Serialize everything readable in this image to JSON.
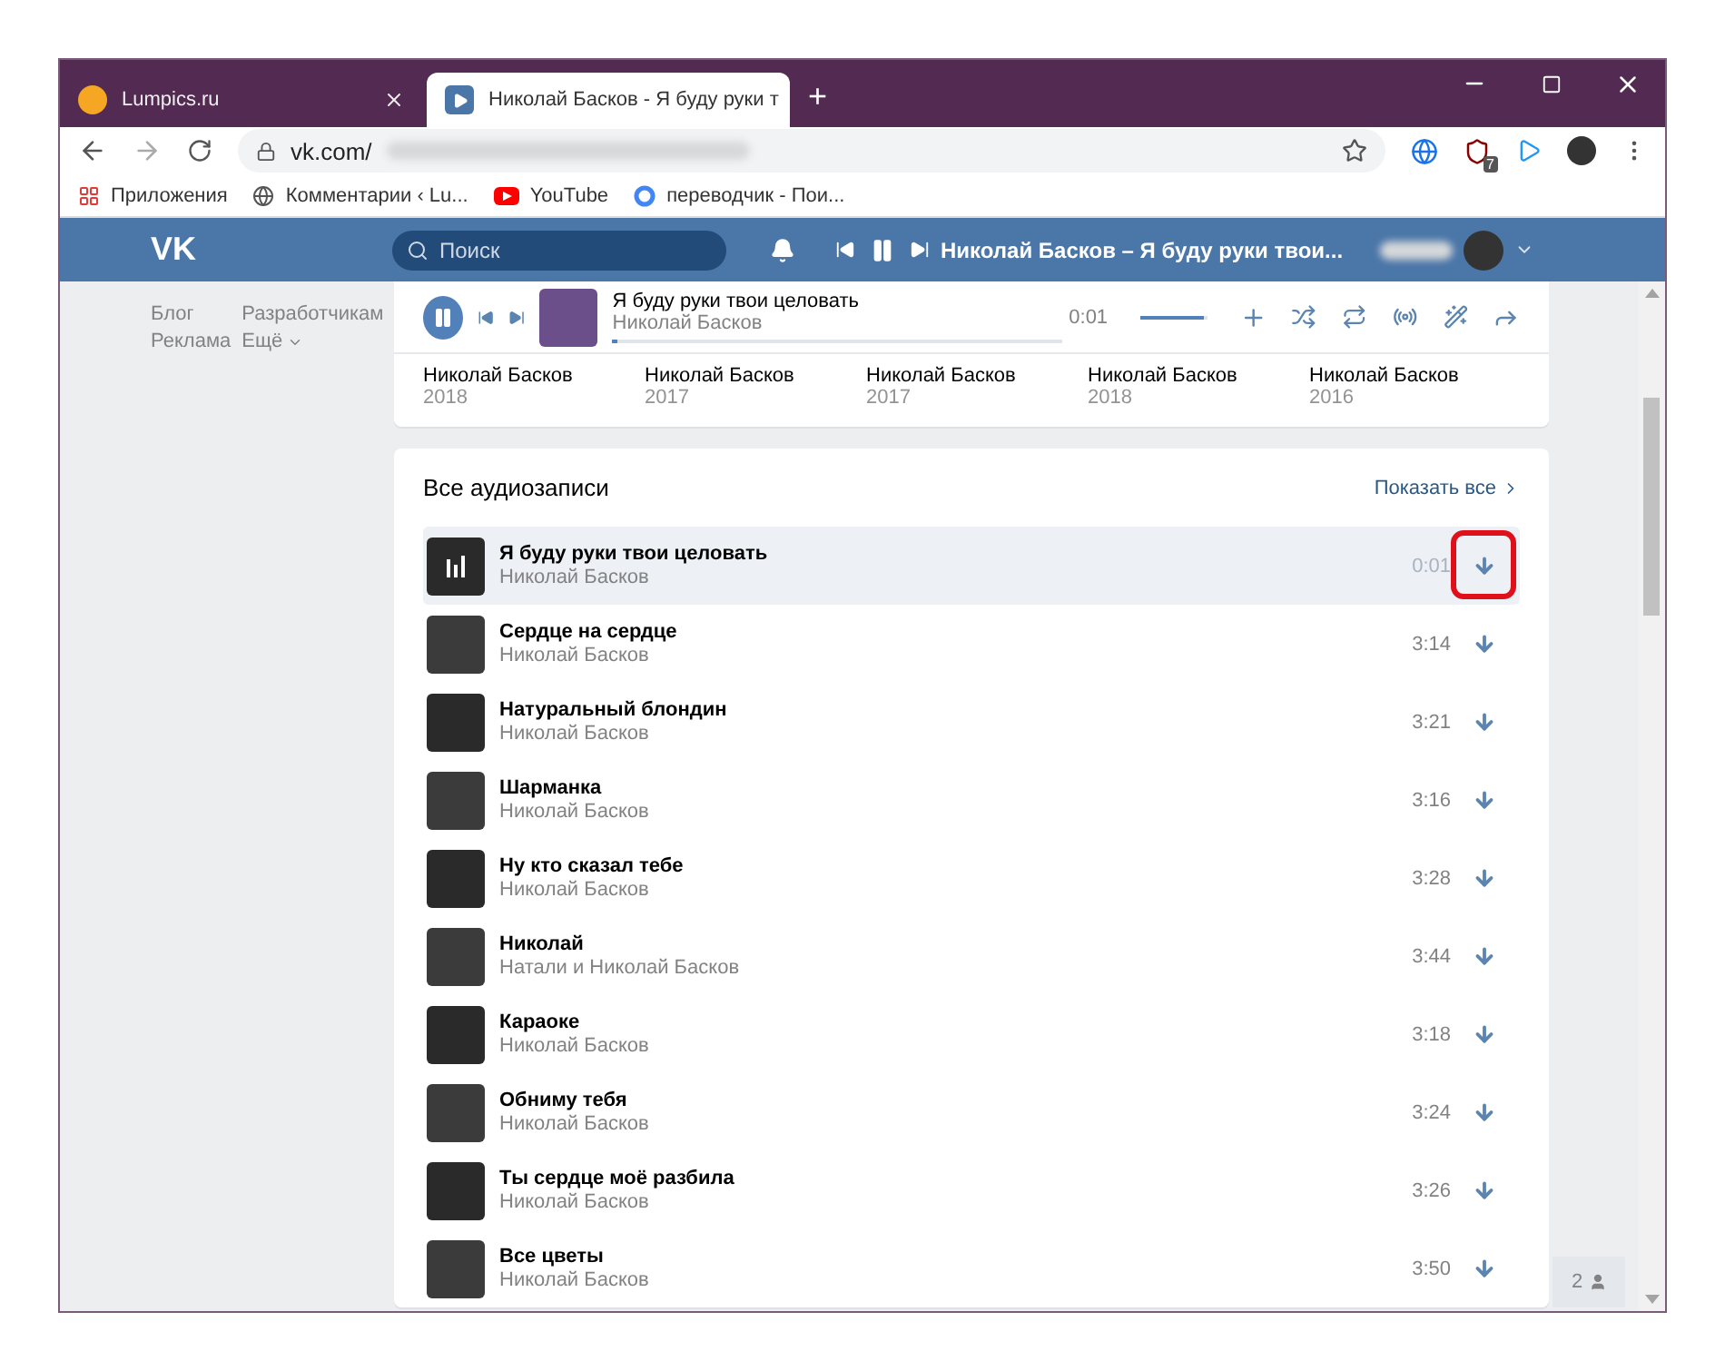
{
  "browser": {
    "tabs": [
      {
        "title": "Lumpics.ru",
        "selected": false,
        "kind": "site"
      },
      {
        "title": "Николай Басков - Я буду руки т",
        "selected": true,
        "kind": "player"
      }
    ],
    "new_tab": "+",
    "url": "vk.com/",
    "extension_badge": "7",
    "bookmarks": [
      {
        "label": "Приложения",
        "kind": "apps"
      },
      {
        "label": "Комментарии ‹ Lu...",
        "kind": "globe"
      },
      {
        "label": "YouTube",
        "kind": "youtube"
      },
      {
        "label": "переводчик - Пои...",
        "kind": "google"
      }
    ]
  },
  "header": {
    "logo": "VK",
    "search": {
      "placeholder": "Поиск"
    },
    "now_playing": "Николай Басков – Я буду руки твои..."
  },
  "left_nav": [
    {
      "label": "Блог"
    },
    {
      "label": "Разработчикам"
    },
    {
      "label": "Реклама"
    },
    {
      "label": "Ещё",
      "dropdown": true
    }
  ],
  "player": {
    "title": "Я буду руки твои целовать",
    "artist": "Николай Басков",
    "time": "0:01",
    "progress": {
      "level": 0.01
    },
    "volume": {
      "level": 0.95
    }
  },
  "albums": [
    {
      "artist": "Николай Басков",
      "year": "2018"
    },
    {
      "artist": "Николай Басков",
      "year": "2017"
    },
    {
      "artist": "Николай Басков",
      "year": "2017"
    },
    {
      "artist": "Николай Басков",
      "year": "2018"
    },
    {
      "artist": "Николай Басков",
      "year": "2016"
    }
  ],
  "audio_section": {
    "title": "Все аудиозаписи",
    "show_all": "Показать все",
    "tracks": [
      {
        "title": "Я буду руки твои целовать",
        "artist": "Николай Басков",
        "duration": "0:01",
        "selected": true,
        "annotated": true
      },
      {
        "title": "Сердце на сердце",
        "artist": "Николай Басков",
        "duration": "3:14",
        "selected": false,
        "annotated": false
      },
      {
        "title": "Натуральный блондин",
        "artist": "Николай Басков",
        "duration": "3:21",
        "selected": false,
        "annotated": false
      },
      {
        "title": "Шарманка",
        "artist": "Николай Басков",
        "duration": "3:16",
        "selected": false,
        "annotated": false
      },
      {
        "title": "Ну кто сказал тебе",
        "artist": "Николай Басков",
        "duration": "3:28",
        "selected": false,
        "annotated": false
      },
      {
        "title": "Николай",
        "artist": "Натали и Николай Басков",
        "duration": "3:44",
        "selected": false,
        "annotated": false
      },
      {
        "title": "Караоке",
        "artist": "Николай Басков",
        "duration": "3:18",
        "selected": false,
        "annotated": false
      },
      {
        "title": "Обниму тебя",
        "artist": "Николай Басков",
        "duration": "3:24",
        "selected": false,
        "annotated": false
      },
      {
        "title": "Ты сердце моё разбила",
        "artist": "Николай Басков",
        "duration": "3:26",
        "selected": false,
        "annotated": false
      },
      {
        "title": "Все цветы",
        "artist": "Николай Басков",
        "duration": "3:50",
        "selected": false,
        "annotated": false
      }
    ]
  },
  "friends_badge": {
    "count": "2"
  }
}
